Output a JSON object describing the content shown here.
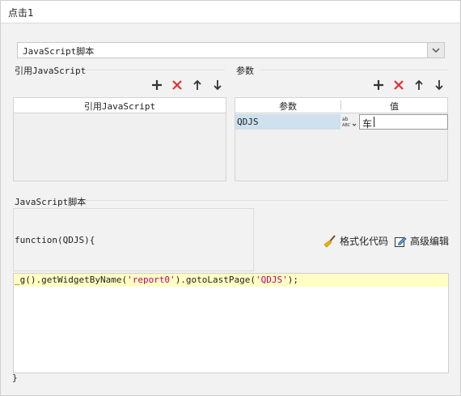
{
  "header": {
    "title": "点击1"
  },
  "script_type": {
    "value": "JavaScript脚本"
  },
  "ref_js": {
    "section_title": "引用JavaScript",
    "column_header": "引用JavaScript"
  },
  "params": {
    "section_title": "参数",
    "columns": [
      "参数",
      "值"
    ],
    "rows": [
      {
        "name": "QDJS",
        "type_icon": "abc-type-icon",
        "value": "车"
      }
    ]
  },
  "script": {
    "section_title": "JavaScript脚本",
    "func_header": "function(QDJS){",
    "format_label": "格式化代码",
    "advanced_label": "高级编辑",
    "code_prefix": "_g().getWidgetByName(",
    "code_str1": "'report0'",
    "code_mid": ").gotoLastPage(",
    "code_str2": "'QDJS'",
    "code_suffix": ");",
    "closing": "}"
  },
  "colors": {
    "add": "#333333",
    "delete": "#e03131",
    "highlight": "#ffffc4",
    "string": "#c0007a"
  }
}
